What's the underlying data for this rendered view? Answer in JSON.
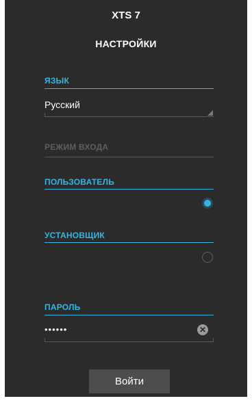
{
  "app": {
    "title": "XTS 7"
  },
  "page": {
    "title": "НАСТРОЙКИ"
  },
  "language": {
    "label": "ЯЗЫК",
    "value": "Русский"
  },
  "login_mode": {
    "label": "РЕЖИМ ВХОДА"
  },
  "user": {
    "label": "ПОЛЬЗОВАТЕЛЬ",
    "selected": true
  },
  "installer": {
    "label": "УСТАНОВЩИК",
    "selected": false
  },
  "password": {
    "label": "ПАРОЛЬ",
    "value": "••••••"
  },
  "login_button": {
    "label": "Войти"
  },
  "colors": {
    "accent": "#33b5e5",
    "background": "#2b2b2b",
    "button": "#4d4d4d"
  },
  "icons": {
    "clear": "clear-circle-icon",
    "spinner": "spinner-corner-icon"
  }
}
